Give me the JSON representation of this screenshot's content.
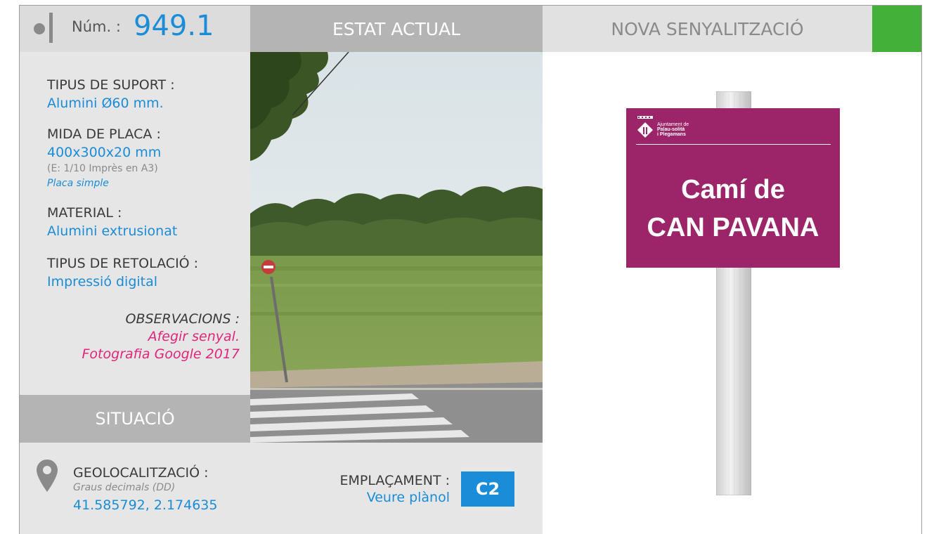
{
  "header": {
    "num_label": "Núm. :",
    "num_value": "949.1",
    "estat_title": "ESTAT ACTUAL",
    "nova_title": "NOVA SENYALITZACIÓ"
  },
  "specs": {
    "suport_label": "TIPUS DE SUPORT :",
    "suport_value": "Alumini Ø60 mm.",
    "mida_label": "MIDA DE PLACA :",
    "mida_value": "400x300x20 mm",
    "mida_note": "(E: 1/10 Imprès en A3)",
    "mida_note2": "Placa simple",
    "material_label": "MATERIAL :",
    "material_value": "Alumini extrusionat",
    "retolacio_label": "TIPUS DE RETOLACIÓ :",
    "retolacio_value": "Impressió digital",
    "obs_label": "OBSERVACIONS :",
    "obs_line1": "Afegir senyal.",
    "obs_line2": "Fotografia Google 2017"
  },
  "situacio": {
    "title": "SITUACIÓ",
    "geo_label": "GEOLOCALITZACIÓ :",
    "geo_note": "Graus decimals (DD)",
    "geo_value": "41.585792, 2.174635",
    "empl_label": "EMPLAÇAMENT :",
    "empl_value": "Veure plànol",
    "empl_code": "C2"
  },
  "sign": {
    "logo_line1": "Ajuntament de",
    "logo_line2": "Palau-solità",
    "logo_line3": "i Plegamans",
    "line1": "Camí de",
    "line2": "CAN PAVANA"
  },
  "colors": {
    "accent_blue": "#1a8cd8",
    "observation_pink": "#e0267c",
    "sign_purple": "#9b2568",
    "status_green": "#43b03a"
  }
}
